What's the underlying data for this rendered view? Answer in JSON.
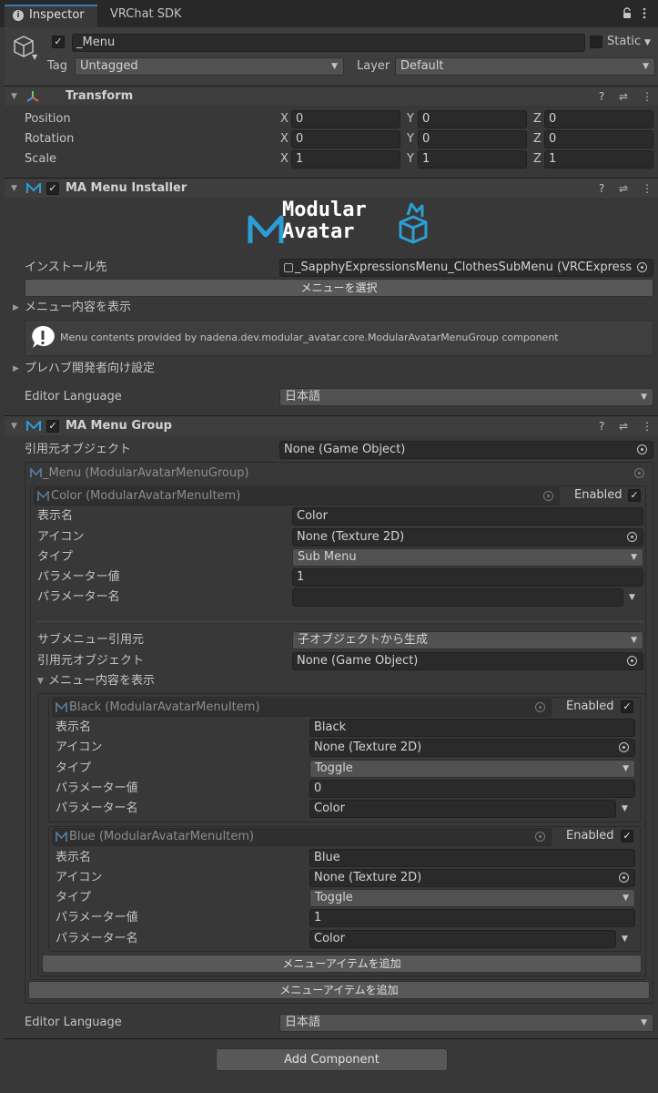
{
  "tabs": {
    "inspector": "Inspector",
    "sdk": "VRChat SDK"
  },
  "object": {
    "name": "_Menu",
    "static_label": "Static",
    "tag_label": "Tag",
    "tag_value": "Untagged",
    "layer_label": "Layer",
    "layer_value": "Default"
  },
  "transform": {
    "title": "Transform",
    "position_label": "Position",
    "rotation_label": "Rotation",
    "scale_label": "Scale",
    "position": [
      "0",
      "0",
      "0"
    ],
    "rotation": [
      "0",
      "0",
      "0"
    ],
    "scale": [
      "1",
      "1",
      "1"
    ],
    "x": "X",
    "y": "Y",
    "z": "Z"
  },
  "installer": {
    "title": "MA Menu Installer",
    "logo_line1": "Modular",
    "logo_line2": "Avatar",
    "install_label": "インストール先",
    "install_value": "_SapphyExpressionsMenu_ClothesSubMenu (VRCExpress",
    "select_menu": "メニューを選択",
    "show_contents": "メニュー内容を表示",
    "info": "Menu contents provided by nadena.dev.modular_avatar.core.ModularAvatarMenuGroup component",
    "prefab_settings": "プレハブ開発者向け設定",
    "lang_label": "Editor Language",
    "lang_value": "日本語"
  },
  "group": {
    "title": "MA Menu Group",
    "source_label": "引用元オブジェクト",
    "source_value": "None (Game Object)",
    "inner_title": "_Menu (ModularAvatarMenuGroup)",
    "add_item": "メニューアイテムを追加",
    "lang_label": "Editor Language",
    "lang_value": "日本語"
  },
  "color_item": {
    "title": "Color (ModularAvatarMenuItem)",
    "enabled": "Enabled",
    "name_label": "表示名",
    "name_value": "Color",
    "icon_label": "アイコン",
    "icon_value": "None (Texture 2D)",
    "type_label": "タイプ",
    "type_value": "Sub Menu",
    "param_value_label": "パラメーター値",
    "param_value": "1",
    "param_name_label": "パラメーター名",
    "param_name": "",
    "submenu_source_label": "サブメニュー引用元",
    "submenu_source_value": "子オブジェクトから生成",
    "source_obj_label": "引用元オブジェクト",
    "source_obj_value": "None (Game Object)",
    "show_contents": "メニュー内容を表示",
    "add_item": "メニューアイテムを追加"
  },
  "black_item": {
    "title": "Black (ModularAvatarMenuItem)",
    "enabled": "Enabled",
    "name_label": "表示名",
    "name_value": "Black",
    "icon_label": "アイコン",
    "icon_value": "None (Texture 2D)",
    "type_label": "タイプ",
    "type_value": "Toggle",
    "param_value_label": "パラメーター値",
    "param_value": "0",
    "param_name_label": "パラメーター名",
    "param_name": "Color"
  },
  "blue_item": {
    "title": "Blue (ModularAvatarMenuItem)",
    "enabled": "Enabled",
    "name_label": "表示名",
    "name_value": "Blue",
    "icon_label": "アイコン",
    "icon_value": "None (Texture 2D)",
    "type_label": "タイプ",
    "type_value": "Toggle",
    "param_value_label": "パラメーター値",
    "param_value": "1",
    "param_name_label": "パラメーター名",
    "param_name": "Color"
  },
  "footer": {
    "add_component": "Add Component"
  },
  "icons": {
    "inspector_tab": "info-icon",
    "lock": "lock-icon",
    "menu": "kebab-menu-icon",
    "cube": "cube-icon",
    "transform": "transform-axes-icon",
    "help": "help-icon",
    "preset": "preset-sliders-icon",
    "more": "more-vertical-icon",
    "target": "object-picker-icon",
    "ma": "modular-avatar-icon"
  },
  "colors": {
    "background": "#383838",
    "field": "#2a2a2a",
    "accent": "#2a9fd6"
  }
}
